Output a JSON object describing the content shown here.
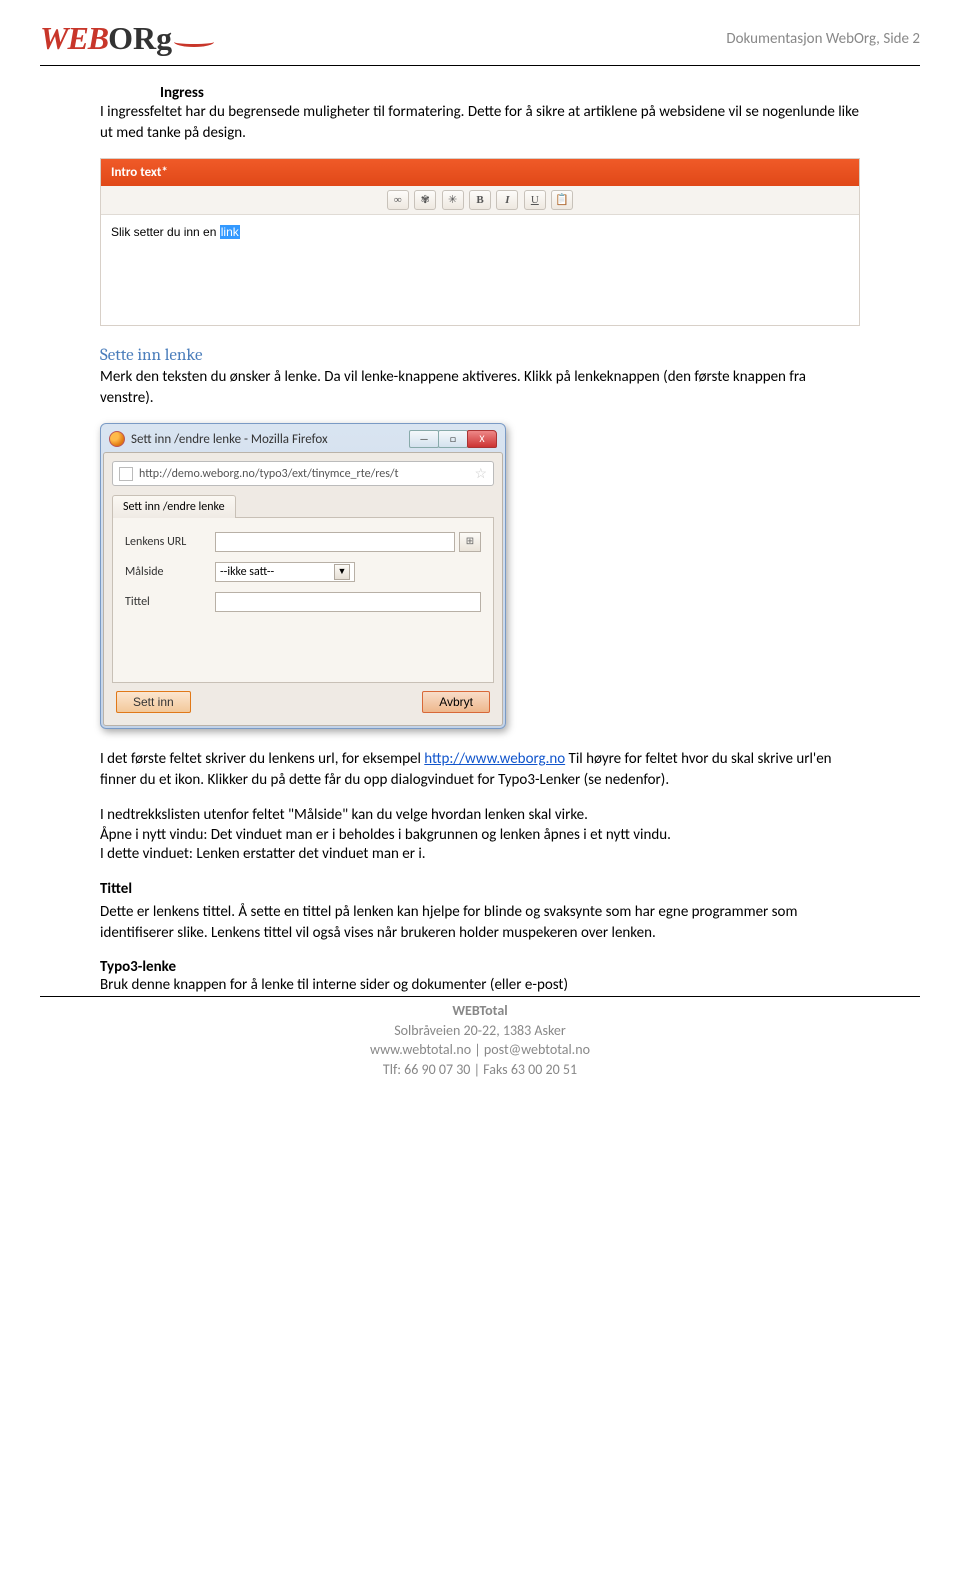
{
  "header": {
    "logo_web": "WEB",
    "logo_org": "ORg",
    "doc_title": "Dokumentasjon WebOrg, Side 2"
  },
  "section_ingress": {
    "heading": "Ingress",
    "body": "I ingressfeltet har du begrensede muligheter til formatering. Dette for å sikre at artiklene på websidene vil se nogenlunde like ut med tanke på design."
  },
  "editor": {
    "title": "Intro text*",
    "toolbar": {
      "link": "∞",
      "unlink": "✾",
      "anchor": "✳",
      "bold": "B",
      "italic": "I",
      "underline": "U",
      "paste": "📋"
    },
    "sample_text_pre": "Slik setter du inn en ",
    "sample_text_link": "link"
  },
  "section_sette": {
    "heading": "Sette inn lenke",
    "body": "Merk den teksten du ønsker å lenke. Da vil lenke-knappene aktiveres. Klikk på lenkeknappen (den første knappen fra venstre)."
  },
  "dialog": {
    "window_title": "Sett inn /endre lenke - Mozilla Firefox",
    "url_bar": "http://demo.weborg.no/typo3/ext/tinymce_rte/res/t",
    "tab_label": "Sett inn /endre lenke",
    "label_url": "Lenkens URL",
    "label_target": "Målside",
    "target_value": "--ikke satt--",
    "label_title": "Tittel",
    "btn_insert": "Sett inn",
    "btn_cancel": "Avbryt",
    "win_min": "—",
    "win_max": "□",
    "win_close": "X"
  },
  "section_first_field": {
    "p1_pre": "I det første feltet skriver du lenkens url, for eksempel ",
    "p1_link": "http://www.weborg.no",
    "p1_post": "  Til høyre for feltet hvor du skal skrive url'en finner du et ikon. Klikker du på dette får du opp dialogvinduet for Typo3-Lenker (se nedenfor).",
    "p2": "I nedtrekkslisten utenfor feltet \"Målside\" kan du velge hvordan lenken skal virke.",
    "p3": "Åpne i nytt vindu:  Det vinduet man er i beholdes i bakgrunnen og lenken åpnes i et nytt vindu.",
    "p4": "I dette vinduet: Lenken erstatter det vinduet man er i."
  },
  "section_tittel": {
    "heading": "Tittel",
    "body": "Dette er lenkens tittel. Å sette en tittel på lenken kan hjelpe for blinde og svaksynte som har egne programmer som identifiserer slike. Lenkens tittel vil også vises når brukeren holder muspekeren over lenken."
  },
  "section_typo3": {
    "heading": "Typo3-lenke",
    "body": "Bruk denne knappen for å lenke til interne sider og dokumenter (eller e-post)"
  },
  "footer": {
    "company": "WEBTotal",
    "address": "Solbråveien 20-22, 1383 Asker",
    "contact": "www.webtotal.no | post@webtotal.no",
    "phone": "Tlf: 66 90 07 30 | Faks 63 00 20 51"
  }
}
